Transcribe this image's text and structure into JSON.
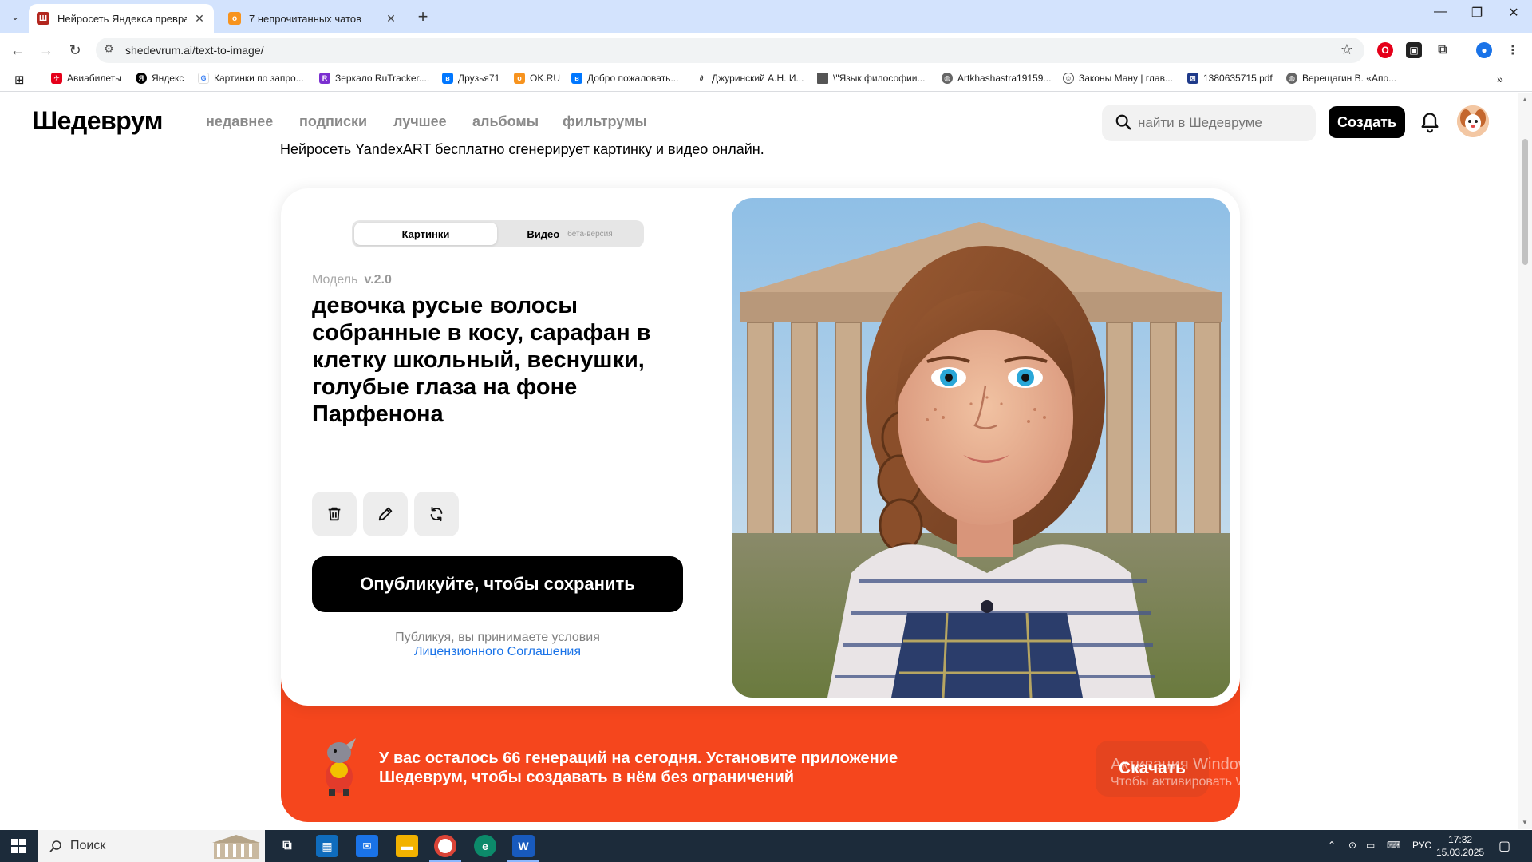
{
  "browser": {
    "tabs": [
      {
        "title": "Нейросеть Яндекса превратит",
        "active": true
      },
      {
        "title": "7 непрочитанных чатов",
        "active": false
      }
    ],
    "url": "shedevrum.ai/text-to-image/",
    "bookmarks": [
      "Авиабилеты",
      "Яндекс",
      "Картинки по запро...",
      "Зеркало RuTracker....",
      "Друзья71",
      "OK.RU",
      "Добро пожаловать...",
      "Джуринский А.Н. И...",
      "\\\"Язык философии...",
      "Artkhashastra19159...",
      "Законы Ману | глав...",
      "1380635715.pdf",
      "Верещагин В. «Апо..."
    ]
  },
  "site": {
    "logo": "Шедеврум",
    "nav": [
      "недавнее",
      "подписки",
      "лучшее",
      "альбомы",
      "фильтрумы"
    ],
    "search_placeholder": "найти в Шедевруме",
    "create_label": "Создать"
  },
  "main": {
    "intro": "Нейросеть YandexART бесплатно сгенерирует картинку и видео онлайн.",
    "tabs": {
      "images": "Картинки",
      "video": "Видео",
      "video_badge": "бета-версия"
    },
    "model_label": "Модель",
    "model_version": "v.2.0",
    "prompt": "девочка русые волосы собранные в косу, сарафан в клетку школьный, веснушки, голубые глаза на фоне Парфенона",
    "publish_label": "Опубликуйте, чтобы сохранить",
    "terms_text": "Публикуя, вы принимаете условия",
    "terms_link": "Лицензионного Соглашения"
  },
  "banner": {
    "line1": "У вас осталось 66 генераций на сегодня. Установите приложение",
    "line2": "Шедеврум, чтобы создавать в нём без ограничений",
    "download_label": "Скачать"
  },
  "watermark": {
    "line1": "Активация Windows",
    "line2": "Чтобы активировать Windows, перейдите в раздел \"Параметры\"."
  },
  "taskbar": {
    "search_label": "Поиск",
    "lang": "РУС",
    "time": "17:32",
    "date": "15.03.2025"
  },
  "colors": {
    "accent_orange": "#f5461d",
    "primary_black": "#000000",
    "link_blue": "#1a73e8"
  }
}
